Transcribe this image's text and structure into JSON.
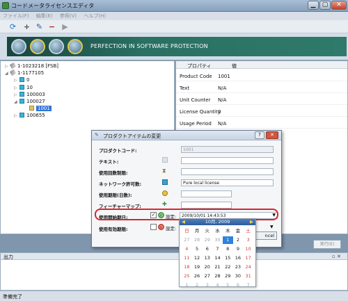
{
  "title": "コードメータライセンスエディタ",
  "menu": [
    "ファイル(F)",
    "編集(E)",
    "参照(V)",
    "ヘルプ(H)"
  ],
  "banner": {
    "text": "PERFECTION IN SOFTWARE PROTECTION"
  },
  "tree": [
    {
      "label": "1-1023218 [FSB]",
      "icon": "key"
    },
    {
      "label": "1-1177105",
      "icon": "key"
    },
    {
      "label": "0",
      "icon": "cube"
    },
    {
      "label": "10",
      "icon": "cube"
    },
    {
      "label": "100003",
      "icon": "cube"
    },
    {
      "label": "100027",
      "icon": "cube"
    },
    {
      "label": "1001",
      "icon": "folder"
    },
    {
      "label": "100655",
      "icon": "cube"
    }
  ],
  "props": {
    "h1": "プロパティ",
    "h2": "値",
    "rows": [
      [
        "Product Code",
        "1001"
      ],
      [
        "Text",
        "N/A"
      ],
      [
        "Unit Counter",
        "N/A"
      ],
      [
        "License Quantity",
        "0"
      ],
      [
        "Usage Period",
        "N/A"
      ]
    ]
  },
  "exec": "実行(E)",
  "output": {
    "title": "出力",
    "pin": "▫ ✕"
  },
  "status": "準備完了",
  "dialog": {
    "title": "プロダクトアイテムの変更",
    "fields": [
      {
        "label": "プロダクトコード:",
        "value": "1001"
      },
      {
        "label": "テキスト:",
        "value": ""
      },
      {
        "label": "使用回数制限:",
        "value": ""
      },
      {
        "label": "ネットワーク許可数:",
        "value": "Pure local license"
      },
      {
        "label": "使用期限(日数):",
        "value": ""
      },
      {
        "label": "フィーチャーマップ:",
        "value": ""
      },
      {
        "label": "使用開始期日:",
        "value": "2009/10/01 14:43:53"
      },
      {
        "label": "使用有効期限:",
        "value": ""
      }
    ],
    "setting": "設定:",
    "cancel": "ncel"
  },
  "calendar": {
    "month": "10月, 2009",
    "days": [
      "日",
      "月",
      "火",
      "水",
      "木",
      "金",
      "土"
    ],
    "dates": [
      "27",
      "28",
      "29",
      "30",
      "1",
      "2",
      "3",
      "4",
      "5",
      "6",
      "7",
      "8",
      "9",
      "10",
      "11",
      "12",
      "13",
      "14",
      "15",
      "16",
      "17",
      "18",
      "19",
      "20",
      "21",
      "22",
      "23",
      "24",
      "25",
      "26",
      "27",
      "28",
      "29",
      "30",
      "31",
      "1",
      "2",
      "3",
      "4",
      "5",
      "6",
      "7"
    ]
  },
  "colors": {
    "accent": "#2f83da",
    "highlight": "#d8262b"
  }
}
